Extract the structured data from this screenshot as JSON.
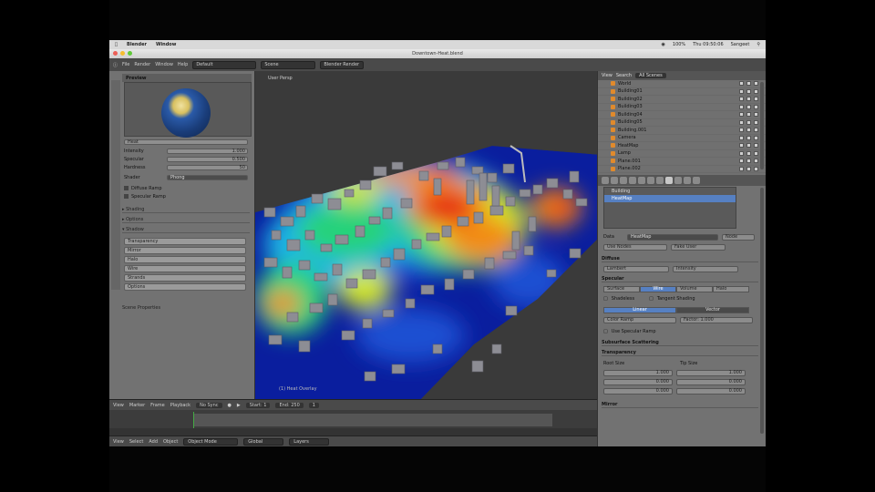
{
  "menubar": {
    "app": "Blender",
    "window": "Window",
    "wifi": "100% ",
    "clock": "Thu 09:50:06",
    "user": "Sangeet"
  },
  "window": {
    "title": "Downtown-Heat.blend"
  },
  "header": {
    "menus": [
      "File",
      "Render",
      "Window",
      "Help"
    ],
    "layout": "Default",
    "scene": "Scene",
    "engine": "Blender Render"
  },
  "left_panel": {
    "header": "Preview",
    "material_name": "Heat",
    "fields": [
      {
        "label": "Intensity",
        "value": "1.000"
      },
      {
        "label": "Specular",
        "value": "0.500"
      },
      {
        "label": "Hardness",
        "value": "50"
      }
    ],
    "shader": "Phong",
    "checks": [
      "Diffuse Ramp",
      "Specular Ramp"
    ],
    "sections": [
      "Shading",
      "Options",
      "Shadow"
    ],
    "buttons": [
      "Transparency",
      "Mirror",
      "Halo",
      "Wire",
      "Strands",
      "Options"
    ],
    "footer": "Scene Properties"
  },
  "viewport": {
    "view_label": "User Persp",
    "object_label": "(1) Heat Overlay",
    "heatmap_colors": [
      "#0a1e9e",
      "#1e50d2",
      "#1fb4e6",
      "#27d27a",
      "#d2e626",
      "#f28c14",
      "#e62814"
    ]
  },
  "timeline": {
    "header": [
      "View",
      "Marker",
      "Frame",
      "Playback"
    ],
    "sync": "No Sync",
    "start": "Start: 1",
    "end": "End: 250",
    "frame": "1"
  },
  "bottombar": {
    "items": [
      "View",
      "Select",
      "Add",
      "Object"
    ],
    "mode": "Object Mode",
    "pivot": "Global",
    "layer": "Layers"
  },
  "outliner": {
    "view": "View",
    "search": "Search",
    "filter": "All Scenes",
    "items": [
      "World",
      "Building01",
      "Building02",
      "Building03",
      "Building04",
      "Building05",
      "Building.001",
      "Camera",
      "HeatMap",
      "Lamp",
      "Plane.001",
      "Plane.002"
    ]
  },
  "properties": {
    "materials": [
      "Building",
      "HeatMap"
    ],
    "data_label": "Data",
    "node_label": "Node",
    "use_nodes": "Use Nodes",
    "fake_user": "Fake User",
    "diffuse_section": "Diffuse",
    "specular_section": "Specular",
    "tabs_diffuse": [
      "Lambert",
      "Intensity"
    ],
    "shading_tabs": [
      "Surface",
      "Wire",
      "Volume",
      "Halo"
    ],
    "options": [
      "Shadeless",
      "Tangent Shading",
      "Cubic Interpolation"
    ],
    "color_label": "Color",
    "ramp_label": "Ramp",
    "ramp_options": [
      "Linear",
      "Vector"
    ],
    "ramp_input": "Color Ramp",
    "blend": "Mix",
    "factor": "Factor: 1.000",
    "transparency": "Transparency",
    "mirror": "Mirror",
    "sss": "Subsurface Scattering",
    "strand_labels": [
      "Root Size",
      "Tip Size"
    ],
    "strand_values": [
      "1.000",
      "1.000",
      "0.000",
      "0.000",
      "0.000",
      "0.000"
    ],
    "check_extra": "Use Specular Ramp"
  }
}
